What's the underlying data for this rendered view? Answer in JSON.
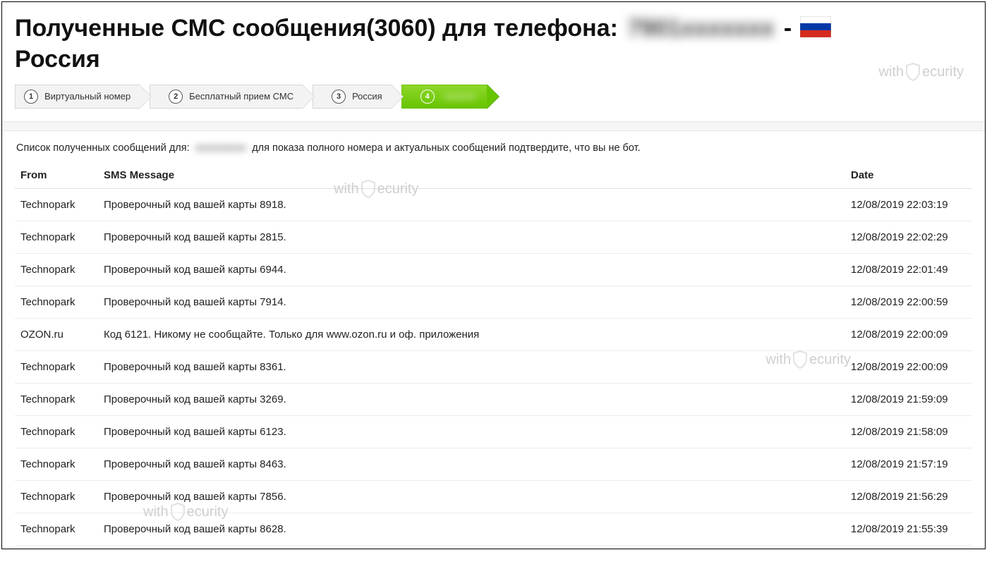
{
  "header": {
    "title_prefix": "Полученные СМС сообщения(3060) для телефона: ",
    "phone_blurred": "7901xxxxxxx",
    "title_sep": " - ",
    "country": "Россия"
  },
  "breadcrumbs": [
    {
      "num": "1",
      "label": "Виртуальный номер",
      "active": false
    },
    {
      "num": "2",
      "label": "Бесплатный прием СМС",
      "active": false
    },
    {
      "num": "3",
      "label": "Россия",
      "active": false
    },
    {
      "num": "4",
      "label_blurred": "xxxxxxx",
      "active": true
    }
  ],
  "notice": {
    "prefix": "Список полученных сообщений для: ",
    "number_blurred": "xxxxxxxxxx",
    "suffix": " для показа полного номера и актуальных сообщений подтвердите, что вы не бот."
  },
  "table": {
    "headers": {
      "from": "From",
      "message": "SMS Message",
      "date": "Date"
    },
    "rows": [
      {
        "from": "Technopark",
        "message": "Проверочный код вашей карты 8918.",
        "date": "12/08/2019 22:03:19"
      },
      {
        "from": "Technopark",
        "message": "Проверочный код вашей карты 2815.",
        "date": "12/08/2019 22:02:29"
      },
      {
        "from": "Technopark",
        "message": "Проверочный код вашей карты 6944.",
        "date": "12/08/2019 22:01:49"
      },
      {
        "from": "Technopark",
        "message": "Проверочный код вашей карты 7914.",
        "date": "12/08/2019 22:00:59"
      },
      {
        "from": "OZON.ru",
        "message": "Код 6121. Никому не сообщайте. Только для www.ozon.ru и оф. приложения",
        "date": "12/08/2019 22:00:09"
      },
      {
        "from": "Technopark",
        "message": "Проверочный код вашей карты 8361.",
        "date": "12/08/2019 22:00:09"
      },
      {
        "from": "Technopark",
        "message": "Проверочный код вашей карты 3269.",
        "date": "12/08/2019 21:59:09"
      },
      {
        "from": "Technopark",
        "message": "Проверочный код вашей карты 6123.",
        "date": "12/08/2019 21:58:09"
      },
      {
        "from": "Technopark",
        "message": "Проверочный код вашей карты 8463.",
        "date": "12/08/2019 21:57:19"
      },
      {
        "from": "Technopark",
        "message": "Проверочный код вашей карты 7856.",
        "date": "12/08/2019 21:56:29"
      },
      {
        "from": "Technopark",
        "message": "Проверочный код вашей карты 8628.",
        "date": "12/08/2019 21:55:39"
      }
    ]
  },
  "watermark": {
    "prefix": "with",
    "suffix": "ecurity"
  }
}
